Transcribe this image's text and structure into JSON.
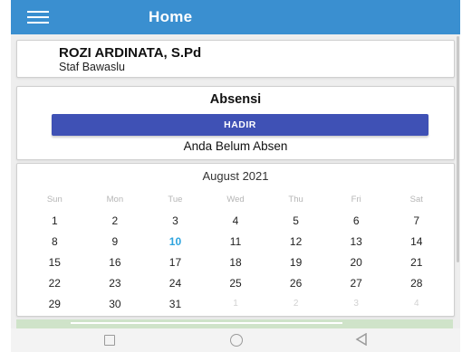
{
  "app": {
    "title": "Home"
  },
  "profile": {
    "name": "ROZI ARDINATA, S.Pd",
    "role": "Staf Bawaslu"
  },
  "absensi": {
    "title": "Absensi",
    "button_label": "HADIR",
    "status": "Anda Belum Absen"
  },
  "calendar": {
    "month_label": "August 2021",
    "weekdays": [
      "Sun",
      "Mon",
      "Tue",
      "Wed",
      "Thu",
      "Fri",
      "Sat"
    ],
    "weeks": [
      [
        " ",
        "1",
        "2",
        "3",
        "4",
        "5",
        "6",
        "7"
      ],
      [
        "8",
        "9",
        "10",
        "11",
        "12",
        "13",
        "14"
      ],
      [
        "15",
        "16",
        "17",
        "18",
        "19",
        "20",
        "21"
      ],
      [
        "22",
        "23",
        "24",
        "25",
        "26",
        "27",
        "28"
      ],
      [
        "29",
        "30",
        "31",
        "1",
        "2",
        "3",
        "4"
      ]
    ],
    "today": "10",
    "accent_color": "#2ea4de"
  },
  "colors": {
    "appbar": "#3a8fd0",
    "button": "#3f51b5"
  },
  "icons": {
    "menu": "menu-icon",
    "nav_recent": "square-icon",
    "nav_home": "circle-icon",
    "nav_back": "back-triangle-icon"
  }
}
